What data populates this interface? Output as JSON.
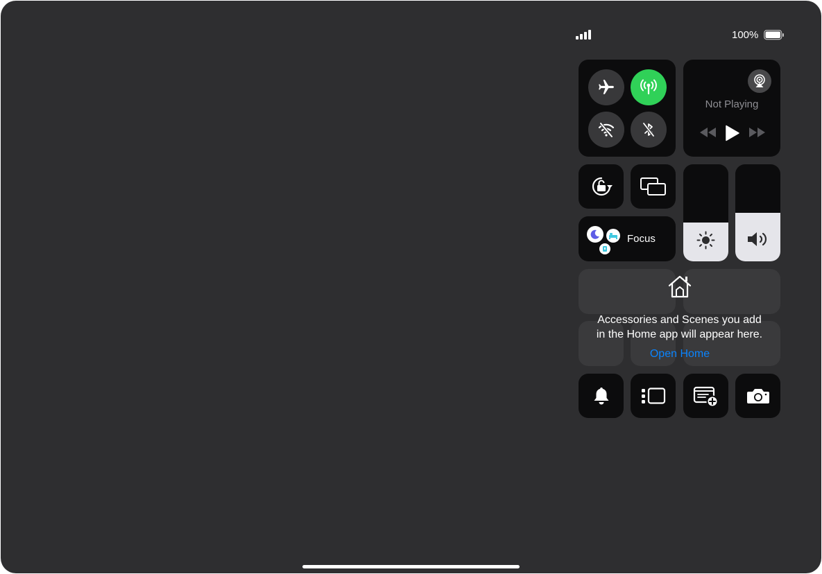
{
  "status_bar": {
    "battery_percent": "100%",
    "battery_level": 1.0,
    "signal_bars": 4
  },
  "connectivity": {
    "airplane_mode": false,
    "cellular_data": true,
    "wifi": false,
    "bluetooth": false
  },
  "now_playing": {
    "label": "Not Playing"
  },
  "sliders": {
    "brightness_level": 0.4,
    "volume_level": 0.5
  },
  "focus": {
    "label": "Focus"
  },
  "home": {
    "message_line1": "Accessories and Scenes you add",
    "message_line2": "in the Home app will appear here.",
    "link_label": "Open Home"
  },
  "colors": {
    "accent_green": "#30d158",
    "link_blue": "#0a84ff",
    "focus_purple": "#5e5ce6",
    "focus_teal": "#40c8e0"
  }
}
